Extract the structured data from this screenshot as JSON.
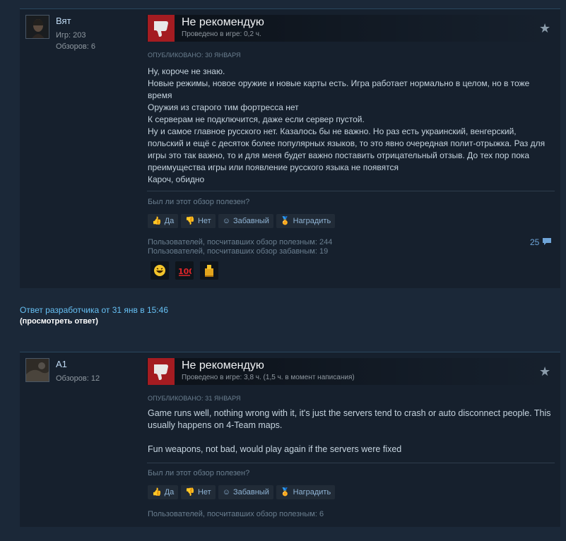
{
  "colors": {
    "background": "#1b2838",
    "card": "#16202d",
    "not_recommended": "#a41c21",
    "link": "#66c0f4",
    "button_text": "#8fb3d4"
  },
  "reviews": [
    {
      "author": {
        "name": "Вят",
        "games": "Игр: 203",
        "reviews": "Обзоров: 6",
        "avatar_icon": "avatar-image"
      },
      "verdict": "Не рекомендую",
      "hours": "Проведено в игре: 0,2 ч.",
      "posted": "ОПУБЛИКОВАНО: 30 ЯНВАРЯ",
      "body": [
        "Ну, короче не знаю.",
        "Новые режимы, новое оружие и новые карты есть. Игра работает нормально в целом, но в тоже время",
        "Оружия из старого тим фортресса нет",
        "К серверам не подключится, даже если сервер пустой.",
        "Ну и самое главное русского нет. Казалось бы не важно. Но раз есть украинский, венгерский, польский и ещё с десяток более популярных языков, то это явно очередная полит-отрыжка. Раз для игры это так важно, то и для меня будет важно поставить отрицательный отзыв. До тех пор пока преимущества игры или появление русского языка не появятся",
        "Кароч, обидно"
      ],
      "helpful_question": "Был ли этот обзор полезен?",
      "buttons": {
        "yes": "Да",
        "no": "Нет",
        "funny": "Забавный",
        "award": "Наградить"
      },
      "helpful_count": "Пользователей, посчитавших обзор полезным: 244",
      "funny_count": "Пользователей, посчитавших обзор забавным: 19",
      "comments_count": "25",
      "awards": [
        "laughing-face-icon",
        "hundred-points-icon",
        "gold-trophy-icon"
      ]
    },
    {
      "author": {
        "name": "A1",
        "reviews": "Обзоров: 12",
        "avatar_icon": "avatar-image"
      },
      "verdict": "Не рекомендую",
      "hours": "Проведено в игре: 3,8 ч. (1,5 ч. в момент написания)",
      "posted": "ОПУБЛИКОВАНО: 31 ЯНВАРЯ",
      "body": [
        "Game runs well, nothing wrong with it, it's just the servers tend to crash or auto disconnect people. This usually happens on 4-Team maps.",
        "",
        "Fun weapons, not bad, would play again if the servers were fixed"
      ],
      "helpful_question": "Был ли этот обзор полезен?",
      "buttons": {
        "yes": "Да",
        "no": "Нет",
        "funny": "Забавный",
        "award": "Наградить"
      },
      "helpful_count": "Пользователей, посчитавших обзор полезным: 6"
    }
  ],
  "developer_response": {
    "label": "Ответ разработчика от 31 янв в 15:46",
    "view_link": "(просмотреть ответ)"
  }
}
